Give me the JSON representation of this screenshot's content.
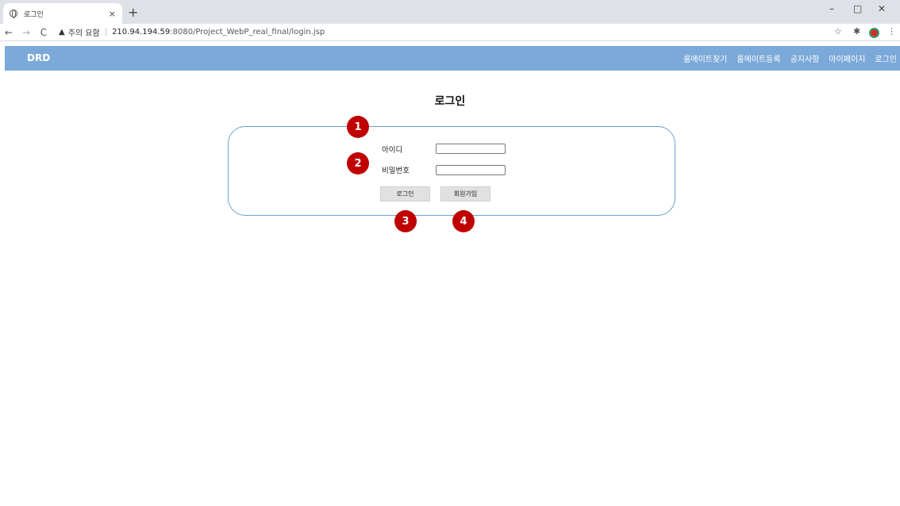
{
  "browser": {
    "tab_title": "로그인",
    "tab_close": "×",
    "new_tab": "+",
    "window_controls": [
      "–",
      "□",
      "✕"
    ],
    "security_warning": "주의 요함",
    "url_host": "210.94.194.59",
    "url_path": ":8080/Project_WebP_real_final/login.jsp"
  },
  "navbar": {
    "logo": "DRD",
    "items": [
      "룸메이트찾기",
      "룸메이트등록",
      "공지사항",
      "마이페이지",
      "로그인"
    ]
  },
  "page": {
    "title": "로그인",
    "id_label": "아이디",
    "password_label": "비밀번호",
    "login_button": "로그인",
    "signup_button": "회원가입"
  },
  "markers": [
    "1",
    "2",
    "3",
    "4"
  ],
  "colors": {
    "navbar": "#7ba9d9",
    "box_border": "#6e9fd1",
    "marker": "#c00000"
  }
}
